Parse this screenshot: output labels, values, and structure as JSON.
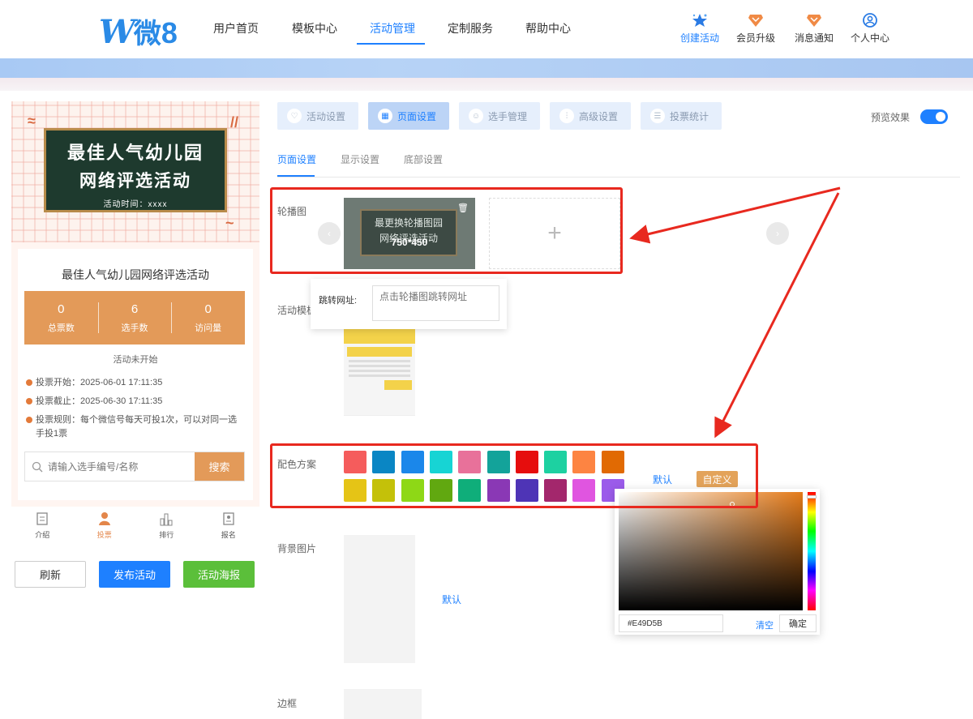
{
  "header": {
    "logo": {
      "w": "W",
      "wei": "微",
      "eight": "8"
    },
    "menu": [
      "用户首页",
      "模板中心",
      "活动管理",
      "定制服务",
      "帮助中心"
    ],
    "actions": [
      {
        "label": "创建活动",
        "icon": "star-sparkle-icon"
      },
      {
        "label": "会员升级",
        "icon": "diamond-badge-icon"
      },
      {
        "label": "消息通知",
        "icon": "bell-badge-icon"
      },
      {
        "label": "个人中心",
        "icon": "user-circle-icon"
      }
    ],
    "colors": {
      "accent": "#1e80ff",
      "brand": "#2a8ae6"
    }
  },
  "preview": {
    "banner": {
      "line1": "最佳人气幼儿园",
      "line2": "网络评选活动",
      "line3": "活动时间：xxxx"
    },
    "title": "最佳人气幼儿园网络评选活动",
    "stats": [
      {
        "num": "0",
        "label": "总票数"
      },
      {
        "num": "6",
        "label": "选手数"
      },
      {
        "num": "0",
        "label": "访问量"
      }
    ],
    "status": "活动未开始",
    "rules": [
      "投票开始：2025-06-01 17:11:35",
      "投票截止：2025-06-30 17:11:35",
      "投票规则：每个微信号每天可投1次，可以对同一选手投1票"
    ],
    "search": {
      "placeholder": "请输入选手编号/名称",
      "button": "搜索"
    },
    "tabs": [
      "介绍",
      "投票",
      "排行",
      "报名"
    ],
    "buttons": {
      "refresh": "刷新",
      "publish": "发布活动",
      "poster": "活动海报"
    },
    "colors": {
      "orange": "#e39a59"
    }
  },
  "settings": {
    "toptabs": [
      "活动设置",
      "页面设置",
      "选手管理",
      "高级设置",
      "投票统计"
    ],
    "preview_label": "预览效果",
    "subtabs": [
      "页面设置",
      "显示设置",
      "底部设置"
    ],
    "labels": {
      "carousel": "轮播图",
      "template": "活动模板",
      "color": "配色方案",
      "bgimage": "背景图片",
      "border": "边框"
    },
    "carousel": {
      "img_line1": "最更换轮播图园",
      "img_line2": "网络评选活动",
      "size": "750*450",
      "add": "+"
    },
    "popover": {
      "label": "跳转网址:",
      "placeholder": "点击轮播图跳转网址"
    },
    "swatches_row1": [
      "#f55c5c",
      "#0a86c4",
      "#1b87ea",
      "#17d4d4",
      "#e8719a",
      "#13a39a",
      "#e60d0d",
      "#1dd1a1",
      "#fd8442",
      "#e16a03"
    ],
    "swatches_row2": [
      "#e5c416",
      "#c4c109",
      "#8ed816",
      "#61a810",
      "#0fae7a",
      "#8a38b5",
      "#4e34b6",
      "#a3276c",
      "#e055e0",
      "#9b5bea"
    ],
    "color_default": "默认",
    "color_custom": "自定义",
    "picker": {
      "hex": "#E49D5B",
      "clear": "清空",
      "confirm": "确定"
    },
    "bg_default": "默认"
  }
}
